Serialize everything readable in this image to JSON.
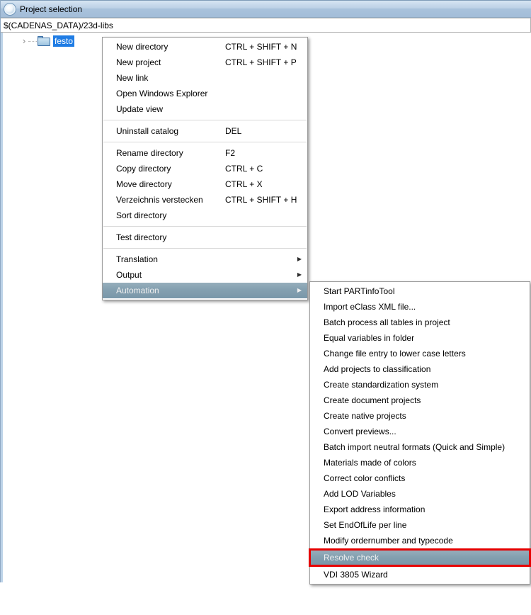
{
  "window": {
    "title": "Project selection",
    "icon": "sphere-icon"
  },
  "path_bar": {
    "value": "$(CADENAS_DATA)/23d-libs"
  },
  "tree": {
    "items": [
      {
        "label": "festo",
        "icon": "folder-icon",
        "selected": true,
        "expandable": true
      }
    ]
  },
  "context_menu": {
    "items": [
      {
        "type": "item",
        "label": "New directory",
        "shortcut": "CTRL + SHIFT + N"
      },
      {
        "type": "item",
        "label": "New project",
        "shortcut": "CTRL + SHIFT + P"
      },
      {
        "type": "item",
        "label": "New link",
        "shortcut": ""
      },
      {
        "type": "item",
        "label": "Open Windows Explorer",
        "shortcut": ""
      },
      {
        "type": "item",
        "label": "Update view",
        "shortcut": ""
      },
      {
        "type": "separator"
      },
      {
        "type": "item",
        "label": "Uninstall catalog",
        "shortcut": "DEL"
      },
      {
        "type": "separator"
      },
      {
        "type": "item",
        "label": "Rename directory",
        "shortcut": "F2"
      },
      {
        "type": "item",
        "label": "Copy directory",
        "shortcut": "CTRL + C"
      },
      {
        "type": "item",
        "label": "Move directory",
        "shortcut": "CTRL + X"
      },
      {
        "type": "item",
        "label": "Verzeichnis verstecken",
        "shortcut": "CTRL + SHIFT + H"
      },
      {
        "type": "item",
        "label": "Sort directory",
        "shortcut": ""
      },
      {
        "type": "separator"
      },
      {
        "type": "item",
        "label": "Test directory",
        "shortcut": ""
      },
      {
        "type": "separator"
      },
      {
        "type": "item",
        "label": "Translation",
        "shortcut": "",
        "has_submenu": true
      },
      {
        "type": "item",
        "label": "Output",
        "shortcut": "",
        "has_submenu": true
      },
      {
        "type": "item",
        "label": "Automation",
        "shortcut": "",
        "has_submenu": true,
        "highlighted": true
      }
    ]
  },
  "submenu": {
    "items": [
      {
        "type": "item",
        "label": "Start PARTinfoTool"
      },
      {
        "type": "item",
        "label": "Import eClass XML file..."
      },
      {
        "type": "item",
        "label": "Batch process all tables in project"
      },
      {
        "type": "item",
        "label": "Equal variables in folder"
      },
      {
        "type": "item",
        "label": "Change file entry to lower case letters"
      },
      {
        "type": "item",
        "label": "Add projects to classification"
      },
      {
        "type": "item",
        "label": "Create standardization system"
      },
      {
        "type": "item",
        "label": "Create document projects"
      },
      {
        "type": "item",
        "label": "Create native projects"
      },
      {
        "type": "item",
        "label": "Convert previews..."
      },
      {
        "type": "item",
        "label": "Batch import neutral formats (Quick and Simple)"
      },
      {
        "type": "item",
        "label": "Materials made of colors"
      },
      {
        "type": "item",
        "label": "Correct color conflicts"
      },
      {
        "type": "item",
        "label": "Add LOD Variables"
      },
      {
        "type": "item",
        "label": "Export address information"
      },
      {
        "type": "item",
        "label": "Set EndOfLife per line"
      },
      {
        "type": "item",
        "label": "Modify ordernumber and typecode"
      },
      {
        "type": "item",
        "label": "Resolve check",
        "highlighted": true,
        "red_outline": true
      },
      {
        "type": "item",
        "label": "VDI 3805 Wizard"
      }
    ]
  },
  "colors": {
    "titlebar_blue": "#a9c2dc",
    "menu_highlight": "#84a0b0",
    "selection_blue": "#1f7ce4",
    "red_outline": "#e60000"
  }
}
